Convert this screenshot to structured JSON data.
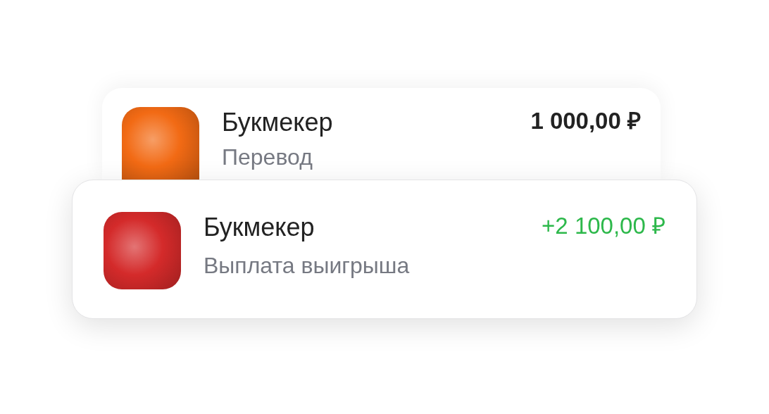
{
  "transactions": [
    {
      "name": "Букмекер",
      "description": "Перевод",
      "amount": "1 000,00 ₽",
      "kind": "expense",
      "color": "#f26a14"
    },
    {
      "name": "Букмекер",
      "description": "Выплата выигрыша",
      "amount": "+2 100,00 ₽",
      "kind": "income",
      "color": "#d42a2a"
    }
  ]
}
